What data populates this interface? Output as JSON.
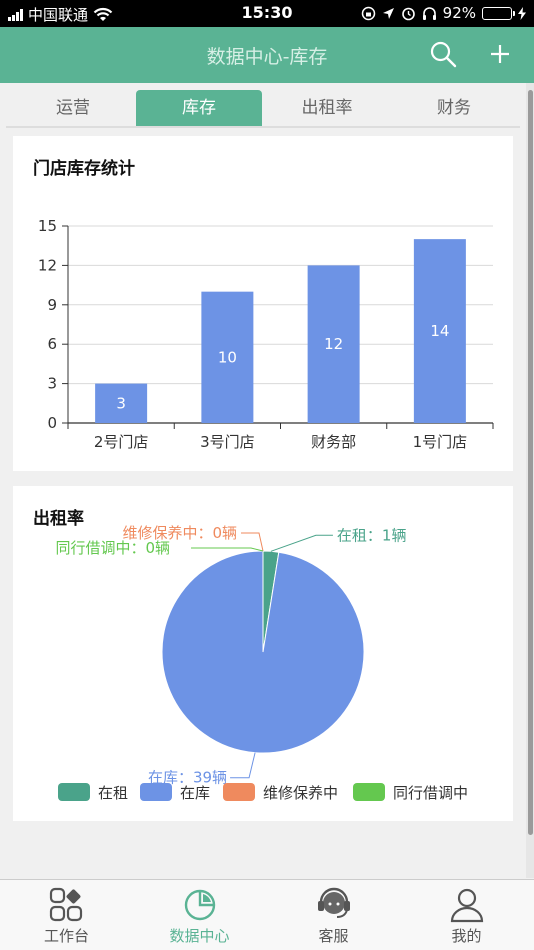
{
  "status_bar": {
    "carrier": "中国联通",
    "time": "15:30",
    "battery": "92%",
    "battery_level": 0.92
  },
  "header": {
    "title": "数据中心-库存",
    "search_icon": "search-icon",
    "add_icon": "plus-icon"
  },
  "tabs": [
    {
      "label": "运营",
      "active": false
    },
    {
      "label": "库存",
      "active": true
    },
    {
      "label": "出租率",
      "active": false
    },
    {
      "label": "财务",
      "active": false
    }
  ],
  "inventory": {
    "title": "门店库存统计"
  },
  "rental": {
    "title": "出租率",
    "legend": [
      {
        "label": "在租"
      },
      {
        "label": "在库"
      },
      {
        "label": "维修保养中"
      },
      {
        "label": "同行借调中"
      }
    ]
  },
  "chart_data": [
    {
      "type": "bar",
      "title": "门店库存统计",
      "categories": [
        "2号门店",
        "3号门店",
        "财务部",
        "1号门店"
      ],
      "values": [
        3,
        10,
        12,
        14
      ],
      "data_labels": [
        "3",
        "10",
        "12",
        "14"
      ],
      "ylim": [
        0,
        15
      ],
      "yticks": [
        "0",
        "3",
        "6",
        "9",
        "12",
        "15"
      ],
      "grid": true,
      "color": "#6d93e5"
    },
    {
      "type": "pie",
      "title": "出租率",
      "slices": [
        {
          "name": "在租",
          "value": 1,
          "label": "在租：1辆",
          "color": "#4aa38a"
        },
        {
          "name": "在库",
          "value": 39,
          "label": "在库：39辆",
          "color": "#6d93e5"
        },
        {
          "name": "维修保养中",
          "value": 0,
          "label": "维修保养中：0辆",
          "color": "#ef8a5e"
        },
        {
          "name": "同行借调中",
          "value": 0,
          "label": "同行借调中：0辆",
          "color": "#64c84f"
        }
      ],
      "legend_position": "bottom"
    }
  ],
  "tabbar": [
    {
      "label": "工作台",
      "icon": "grid-icon",
      "active": false
    },
    {
      "label": "数据中心",
      "icon": "pie-chart-icon",
      "active": true
    },
    {
      "label": "客服",
      "icon": "headset-icon",
      "active": false
    },
    {
      "label": "我的",
      "icon": "user-icon",
      "active": false
    }
  ]
}
